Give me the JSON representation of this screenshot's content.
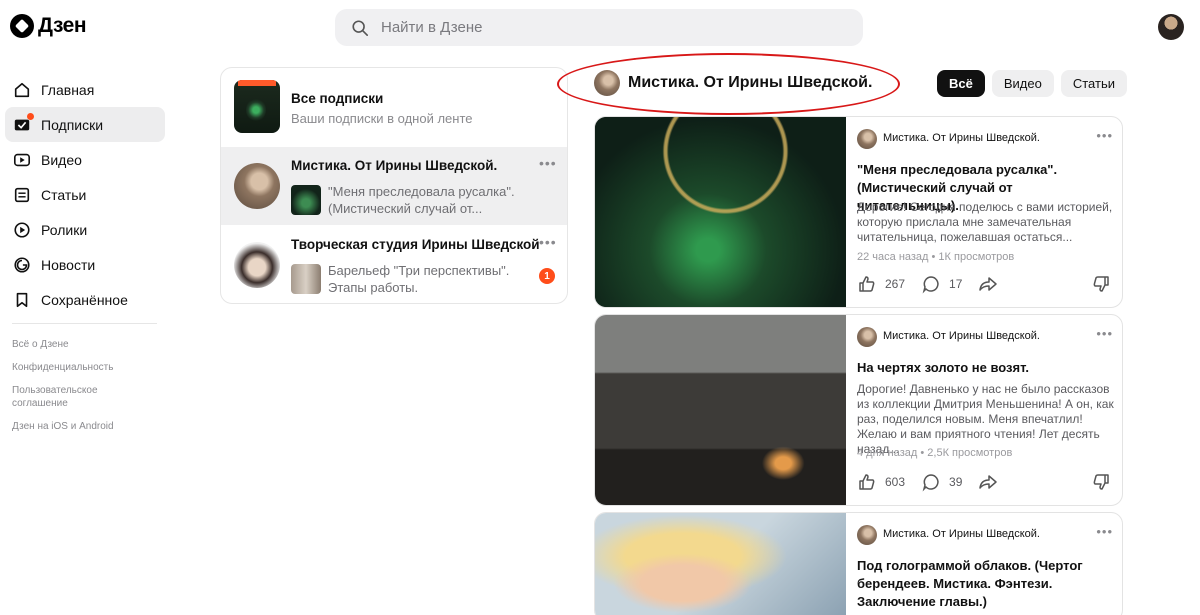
{
  "header": {
    "logo_text": "Дзен",
    "search_placeholder": "Найти в Дзене"
  },
  "sidebar": {
    "items": [
      {
        "label": "Главная",
        "icon": "home-icon"
      },
      {
        "label": "Подписки",
        "icon": "subscriptions-icon"
      },
      {
        "label": "Видео",
        "icon": "video-icon"
      },
      {
        "label": "Статьи",
        "icon": "articles-icon"
      },
      {
        "label": "Ролики",
        "icon": "clips-icon"
      },
      {
        "label": "Новости",
        "icon": "news-icon"
      },
      {
        "label": "Сохранённое",
        "icon": "bookmark-icon"
      }
    ],
    "footer_links": [
      "Всё о Дзене",
      "Конфиденциальность",
      "Пользовательское соглашение",
      "Дзен на iOS и Android"
    ]
  },
  "subscriptions": {
    "all": {
      "title": "Все подписки",
      "desc": "Ваши подписки в одной ленте"
    },
    "channels": [
      {
        "name": "Мистика. От Ирины Шведской.",
        "snippet": "\"Меня преследовала русалка\". (Мистический случай от..."
      },
      {
        "name": "Творческая студия Ирины Шведской",
        "snippet": "Барельеф \"Три перспективы\". Этапы работы.",
        "badge": "1"
      }
    ]
  },
  "channel": {
    "name": "Мистика. От Ирины Шведской.",
    "filters": [
      "Всё",
      "Видео",
      "Статьи"
    ]
  },
  "cards": [
    {
      "channel": "Мистика. От Ирины Шведской.",
      "title": "\"Меня преследовала русалка\". (Мистический случай от читательницы).",
      "text": "Дорогие! Сегодня поделюсь с вами историей, которую прислала мне замечательная читательница, пожелавшая остаться...",
      "meta": "22 часа назад • 1К просмотров",
      "likes": "267",
      "comments": "17"
    },
    {
      "channel": "Мистика. От Ирины Шведской.",
      "title": "На чертях золото не возят.",
      "text": "Дорогие! Давненько у нас не было рассказов из коллекции Дмитрия Меньшенина! А он, как раз, поделился новым. Меня впечатлил! Желаю и вам приятного чтения! Лет десять назад...",
      "meta": "4 дня назад • 2,5К просмотров",
      "likes": "603",
      "comments": "39"
    },
    {
      "channel": "Мистика. От Ирины Шведской.",
      "title": "Под голограммой облаков. (Чертог берендеев. Мистика. Фэнтези. Заключение главы.)"
    }
  ],
  "colors": {
    "accent": "#ff4d1a",
    "annotation": "#d81818"
  }
}
